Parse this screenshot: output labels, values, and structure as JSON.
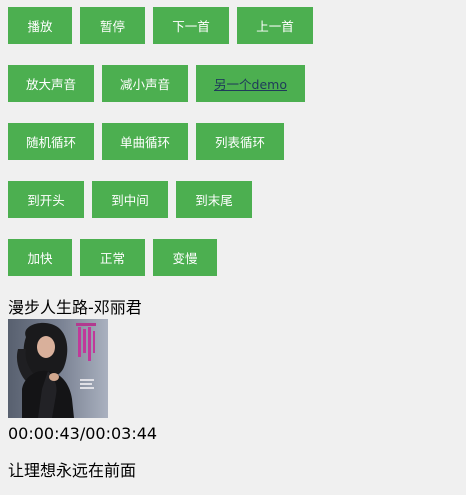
{
  "controls": {
    "row1": {
      "play": "播放",
      "pause": "暂停",
      "next": "下一首",
      "previous": "上一首"
    },
    "row2": {
      "volume_up": "放大声音",
      "volume_down": "减小声音",
      "other_demo": "另一个demo"
    },
    "row3": {
      "shuffle": "随机循环",
      "repeat_one": "单曲循环",
      "repeat_list": "列表循环"
    },
    "row4": {
      "to_start": "到开头",
      "to_middle": "到中间",
      "to_end": "到末尾"
    },
    "row5": {
      "faster": "加快",
      "normal": "正常",
      "slower": "变慢"
    }
  },
  "player": {
    "song_title": "漫步人生路-邓丽君",
    "time_display": "00:00:43/00:03:44",
    "lyric": "让理想永远在前面"
  },
  "colors": {
    "button_bg": "#4caf50",
    "button_text": "#ffffff",
    "page_bg": "#f0f0f0"
  }
}
